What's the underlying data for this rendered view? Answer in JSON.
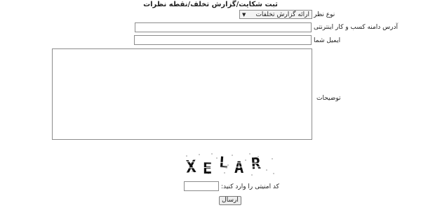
{
  "form": {
    "title": "ثبت شکایت/گزارش تخلف/نقطه نظرات",
    "type_label": "نوع نظر",
    "type_selected": "ارائه گزارش تخلفات",
    "address_label": "آدرس دامنه کسب و کار اینترنتی",
    "address_value": "",
    "email_label": "ایمیل شما",
    "email_value": "",
    "description_label": "توضیحات",
    "description_value": "",
    "captcha_text": "XELAR",
    "captcha_label": "کد امنیتی را وارد کنید:",
    "captcha_value": "",
    "submit_label": "ارسال"
  }
}
